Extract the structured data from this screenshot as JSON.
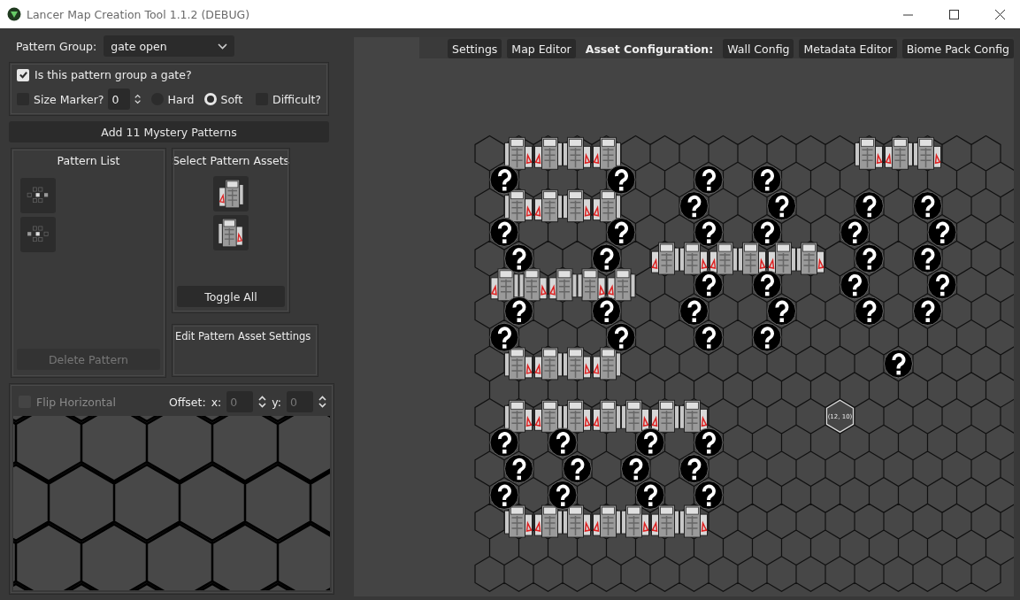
{
  "window": {
    "title": "Lancer Map Creation Tool 1.1.2 (DEBUG)"
  },
  "pattern_group": {
    "label": "Pattern Group:",
    "value": "gate open"
  },
  "gate_options": {
    "gate": {
      "label": "Is this pattern group a gate?",
      "checked": true
    },
    "size_marker": {
      "label": "Size Marker?",
      "checked": false,
      "value": "0"
    },
    "hardness": [
      {
        "label": "Hard",
        "selected": false
      },
      {
        "label": "Soft",
        "selected": true
      }
    ],
    "difficult": {
      "label": "Difficult?",
      "checked": false
    }
  },
  "add_button": "Add 11 Mystery Patterns",
  "pattern_list": {
    "title": "Pattern List",
    "patterns": [
      {
        "kind": "east"
      },
      {
        "kind": "west"
      }
    ],
    "delete_button": {
      "label": "Delete Pattern",
      "disabled": true
    }
  },
  "asset_selection": {
    "title": "Select Pattern Assets",
    "assets": [
      {
        "kind": "right"
      },
      {
        "kind": "left"
      }
    ],
    "toggle_button": "Toggle All"
  },
  "asset_settings": {
    "title": "Edit Pattern Asset Settings"
  },
  "preview": {
    "flip": {
      "label": "Flip Horizontal",
      "checked": false,
      "disabled": true
    },
    "offset_label": "Offset:",
    "x": {
      "label": "x:",
      "value": "0",
      "disabled": true
    },
    "y": {
      "label": "y:",
      "value": "0",
      "disabled": true
    }
  },
  "toolbar": [
    {
      "label": "Settings",
      "kind": "button"
    },
    {
      "label": "Map Editor",
      "kind": "button"
    },
    {
      "label": "Asset Configuration:",
      "kind": "label"
    },
    {
      "label": "Wall Config",
      "kind": "button"
    },
    {
      "label": "Metadata Editor",
      "kind": "button"
    },
    {
      "label": "Biome Pack Config",
      "kind": "button"
    }
  ],
  "map": {
    "hover_label": "(12, 10)"
  }
}
